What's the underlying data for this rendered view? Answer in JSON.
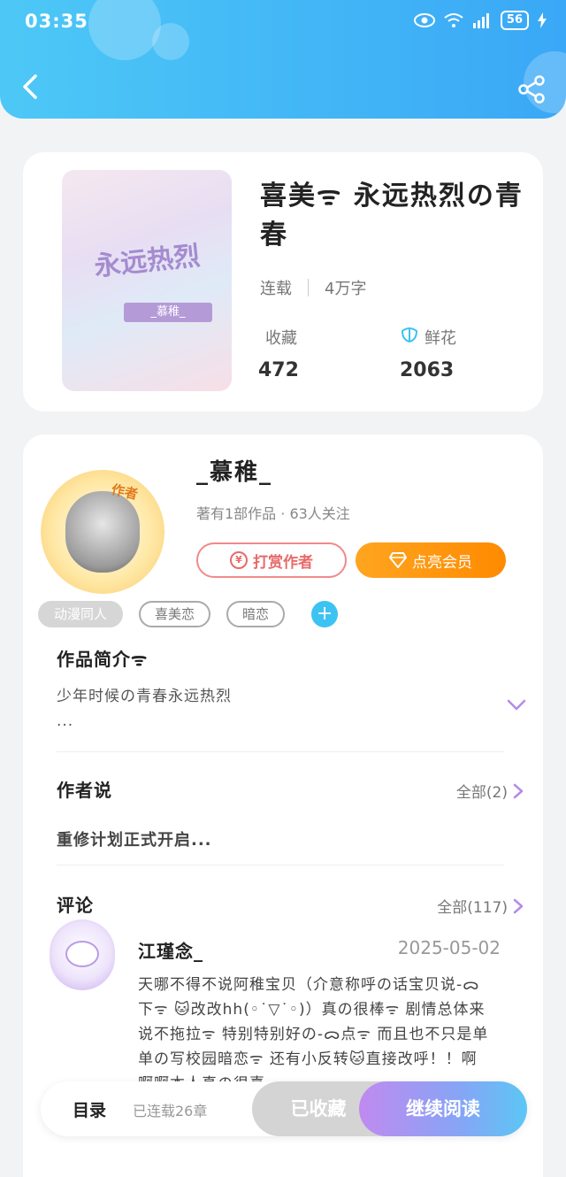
{
  "status_bar": {
    "time": "03:35",
    "battery": "56"
  },
  "book": {
    "title": "喜美ᯤ 永远热烈の青春",
    "status": "连载",
    "word_count": "4万字",
    "cover_title": "永远热烈",
    "cover_author": "_慕稚_",
    "stats": {
      "collect_label": "收藏",
      "collect_value": "472",
      "flower_label": "鲜花",
      "flower_value": "2063"
    }
  },
  "author": {
    "badge": "作者",
    "name": "_慕稚_",
    "summary": "著有1部作品 · 63人关注",
    "reward_label": "打赏作者",
    "vip_label": "点亮会员"
  },
  "tags": [
    "动漫同人",
    "喜美恋",
    "暗恋"
  ],
  "intro": {
    "title": "作品简介ᯤ",
    "text_line1": "少年时候の青春永远热烈",
    "text_line2": "..."
  },
  "author_say": {
    "title": "作者说",
    "more_label": "全部(2)",
    "text": "重修计划正式开启..."
  },
  "comments": {
    "title": "评论",
    "more_label": "全部(117)",
    "first": {
      "name": "江瑾念_",
      "date": "2025-05-02",
      "text": "天哪不得不说阿稚宝贝（介意称呼の话宝贝说-ᯅ下ᯤ 🐱改改hh(◦˙▽˙◦)）真の很棒ᯤ 剧情总体来说不拖拉ᯤ 特别特别好の-ᯅ点ᯤ 而且也不只是单单の写校园暗恋ᯤ 还有小反转🐱直接改呼！！啊啊啊本人真の很喜"
    }
  },
  "bottom_bar": {
    "toc_label": "目录",
    "serial_label": "已连载26章",
    "collected_label": "已收藏",
    "continue_label": "继续阅读"
  },
  "colors": {
    "header": "#3aa8f6",
    "accent_blue": "#3cc3f2",
    "vip_orange": "#ff8a00",
    "reward_red": "#e86a6a",
    "purple": "#b48be6"
  }
}
